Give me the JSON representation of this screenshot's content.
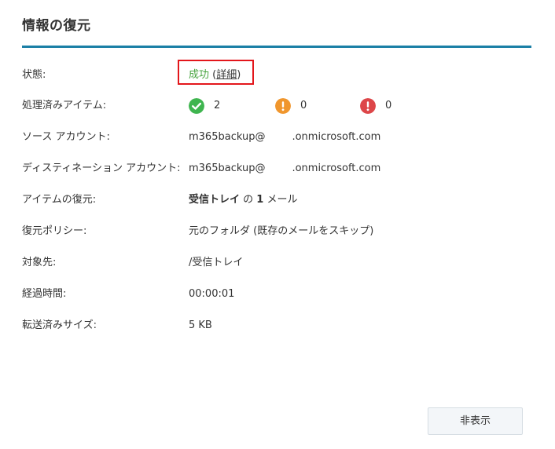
{
  "dialog": {
    "title": "情報の復元",
    "accent_color": "#1b7fa6"
  },
  "status": {
    "label": "状態:",
    "value": "成功",
    "details_open": " (",
    "details_link": "詳細",
    "details_close": ")",
    "value_color": "#48a43f"
  },
  "processed": {
    "label": "処理済みアイテム:",
    "success_count": "2",
    "warning_count": "0",
    "error_count": "0",
    "success_icon": "check-circle-icon",
    "warning_icon": "exclamation-circle-icon",
    "error_icon": "exclamation-circle-icon",
    "success_color": "#3fb54f",
    "warning_color": "#f0962d",
    "error_color": "#dd4649"
  },
  "source_account": {
    "label": "ソース アカウント:",
    "value_user": "m365backup@",
    "value_domain": ".onmicrosoft.com"
  },
  "destination_account": {
    "label": "ディスティネーション アカウント:",
    "value_user": "m365backup@",
    "value_domain": ".onmicrosoft.com"
  },
  "items_restored": {
    "label": "アイテムの復元:",
    "folder": "受信トレイ",
    "middle": " の ",
    "count": "1",
    "suffix": " メール"
  },
  "restore_policy": {
    "label": "復元ポリシー:",
    "value": "元のフォルダ (既存のメールをスキップ)"
  },
  "target": {
    "label": "対象先:",
    "value": "/受信トレイ"
  },
  "elapsed": {
    "label": "経過時間:",
    "value": "00:00:01"
  },
  "transferred": {
    "label": "転送済みサイズ:",
    "value": "5 KB"
  },
  "footer": {
    "hide_button": "非表示"
  }
}
